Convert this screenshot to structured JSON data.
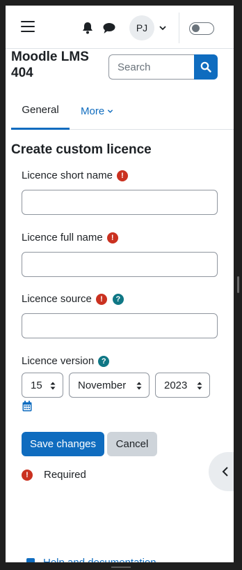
{
  "navbar": {
    "icons": {
      "menu": "hamburger-icon",
      "notifications": "bell-icon",
      "messages": "chat-icon",
      "user_menu": "chevron-down-icon"
    },
    "user_initials": "PJ"
  },
  "header": {
    "site_title": "Moodle LMS 404",
    "search_placeholder": "Search",
    "search_icon": "search-icon"
  },
  "tabs": [
    {
      "label": "General",
      "active": true
    },
    {
      "label": "More",
      "active": false
    }
  ],
  "form": {
    "heading": "Create custom licence",
    "short_name": {
      "label": "Licence short name",
      "value": ""
    },
    "full_name": {
      "label": "Licence full name",
      "value": ""
    },
    "source": {
      "label": "Licence source",
      "value": ""
    },
    "version": {
      "label": "Licence version",
      "day": "15",
      "month": "November",
      "year": "2023"
    },
    "save_label": "Save changes",
    "cancel_label": "Cancel",
    "required_legend": "Required"
  },
  "footer": {
    "help_link": "Help and documentation"
  },
  "colors": {
    "primary": "#0f6cbf",
    "required": "#ca3120",
    "help": "#0f7785"
  }
}
